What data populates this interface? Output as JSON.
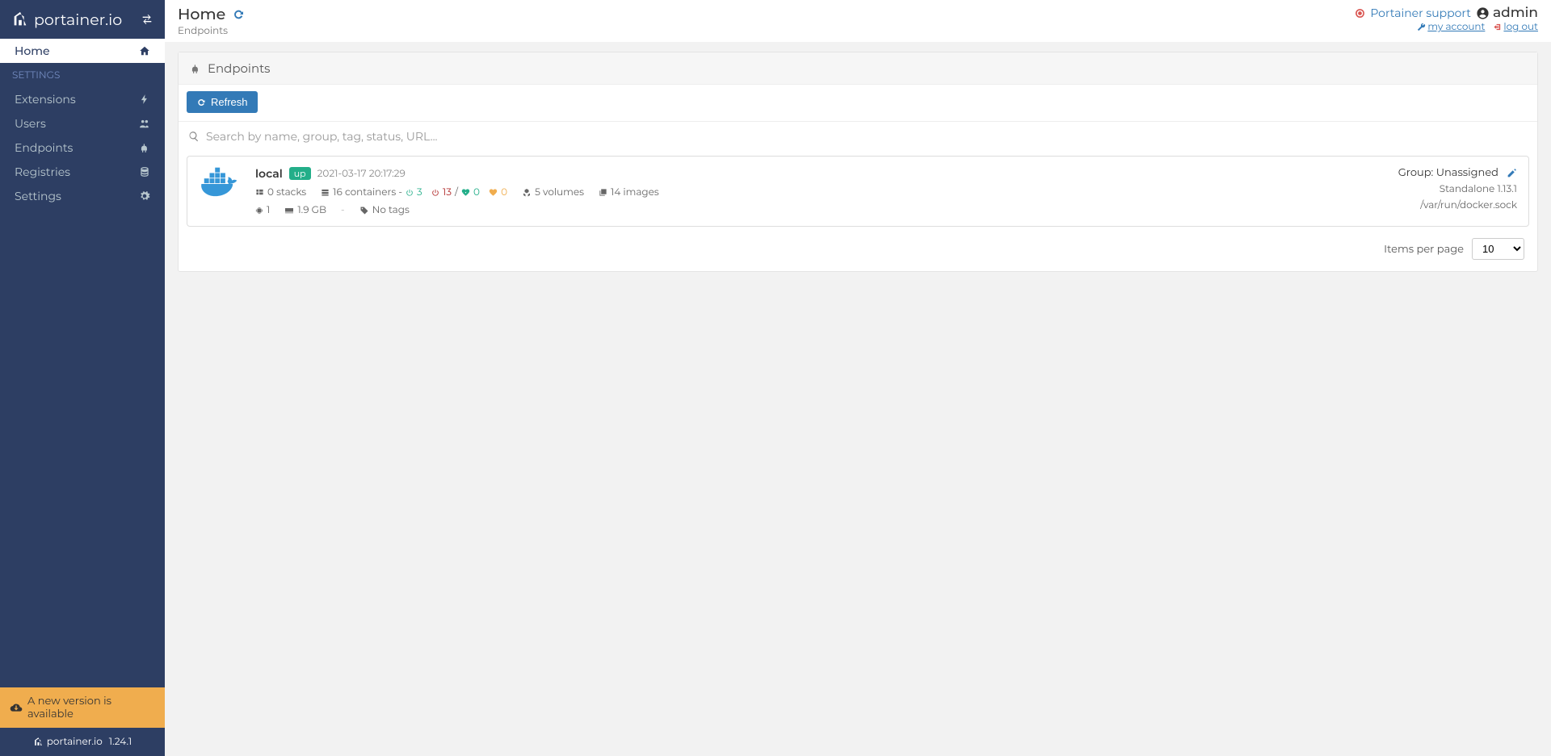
{
  "brand": "portainer.io",
  "sidebar": {
    "items": [
      {
        "label": "Home",
        "active": true,
        "icon": "home-icon"
      },
      {
        "section": "SETTINGS"
      },
      {
        "label": "Extensions",
        "icon": "bolt-icon"
      },
      {
        "label": "Users",
        "icon": "users-icon"
      },
      {
        "label": "Endpoints",
        "icon": "plug-icon"
      },
      {
        "label": "Registries",
        "icon": "database-icon"
      },
      {
        "label": "Settings",
        "icon": "cogs-icon"
      }
    ],
    "update_banner": "A new version is available",
    "footer_brand": "portainer.io",
    "footer_version": "1.24.1"
  },
  "topbar": {
    "title": "Home",
    "subtitle": "Endpoints",
    "support_label": "Portainer support",
    "username": "admin",
    "my_account_label": "my account",
    "log_out_label": "log out"
  },
  "panel": {
    "header": "Endpoints",
    "refresh_label": "Refresh",
    "search_placeholder": "Search by name, group, tag, status, URL...",
    "items_per_page_label": "Items per page",
    "items_per_page_value": "10"
  },
  "endpoint": {
    "name": "local",
    "status_label": "up",
    "timestamp": "2021-03-17 20:17:29",
    "stacks_text": "0 stacks",
    "containers_label_prefix": "16 containers - ",
    "running_count": "3",
    "stopped_count": "13",
    "slash": " / ",
    "healthy_count": "0",
    "unhealthy_count": "0",
    "volumes_text": "5 volumes",
    "images_text": "14 images",
    "cpu_text": "1",
    "memory_text": "1.9 GB",
    "dash": "-",
    "tags_text": "No tags",
    "group_text": "Group: Unassigned",
    "engine_text": "Standalone 1.13.1",
    "socket_text": "/var/run/docker.sock"
  }
}
